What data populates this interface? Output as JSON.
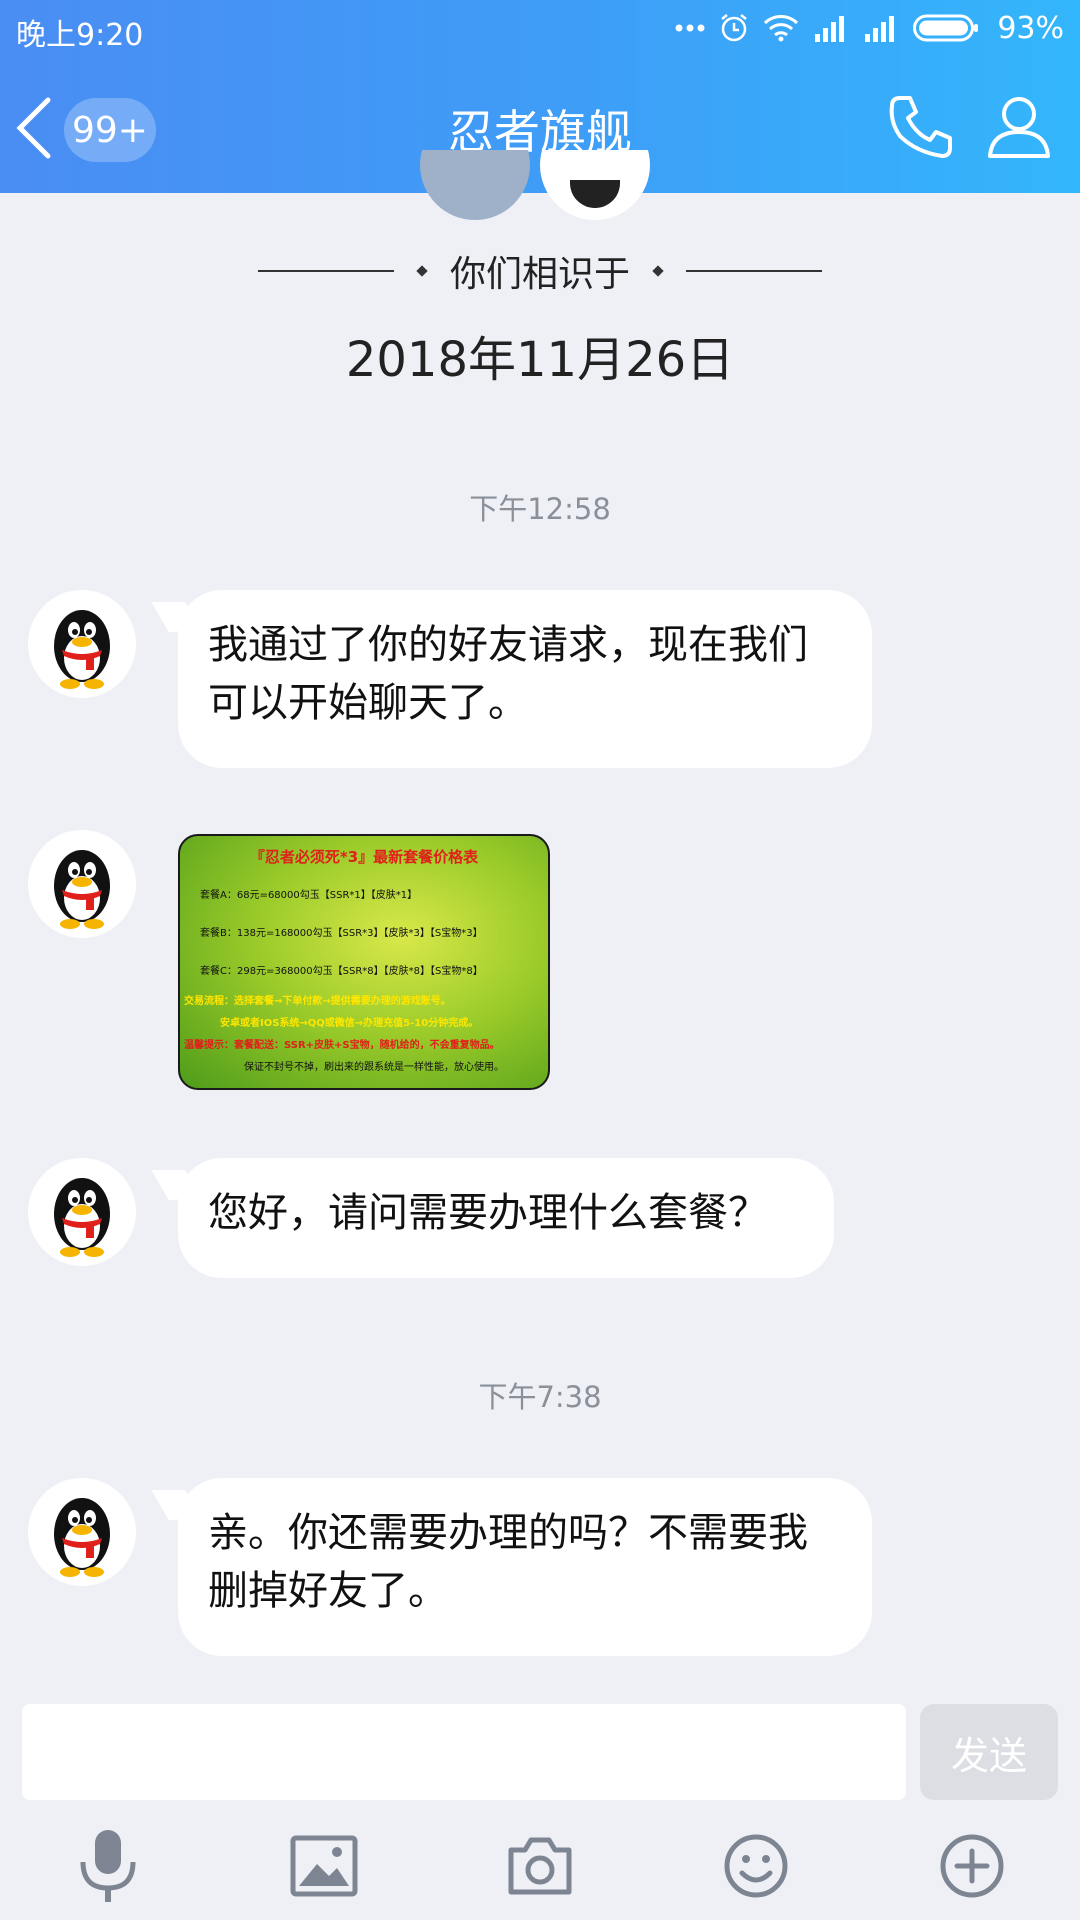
{
  "status_bar": {
    "time": "晚上9:20",
    "battery": "93%"
  },
  "nav": {
    "unread_badge": "99+",
    "title": "忍者旗舰"
  },
  "intro": {
    "met_label": "你们相识于",
    "met_date": "2018年11月26日"
  },
  "messages": {
    "timestamp_1": "下午12:58",
    "msg_1": "我通过了你的好友请求，现在我们可以开始聊天了。",
    "image": {
      "title": "『忍者必须死*3』最新套餐价格表",
      "line_a": "套餐A：68元=68000勾玉【SSR*1】【皮肤*1】",
      "line_b": "套餐B：138元=168000勾玉【SSR*3】【皮肤*3】【S宝物*3】",
      "line_c": "套餐C：298元=368000勾玉【SSR*8】【皮肤*8】【S宝物*8】",
      "line_d": "交易流程：选择套餐→下单付款→提供需要办理的游戏账号。",
      "line_e": "安卓或者IOS系统→QQ或微信→办理充值5-10分钟完成。",
      "line_f": "温馨提示：套餐配送：SSR+皮肤+S宝物，随机给的，不会重复物品。",
      "line_g": "保证不封号不掉，刷出来的跟系统是一样性能，放心使用。"
    },
    "msg_2": "您好，请问需要办理什么套餐？",
    "timestamp_2": "下午7:38",
    "msg_3": "亲。你还需要办理的吗？不需要我删掉好友了。"
  },
  "input": {
    "placeholder": "",
    "send_label": "发送"
  },
  "icons": {
    "tools": [
      "microphone-icon",
      "image-icon",
      "camera-icon",
      "emoji-icon",
      "plus-circle-icon"
    ]
  },
  "colors": {
    "header_start": "#4a8df3",
    "header_end": "#33b6fb",
    "background": "#eef0f6"
  }
}
